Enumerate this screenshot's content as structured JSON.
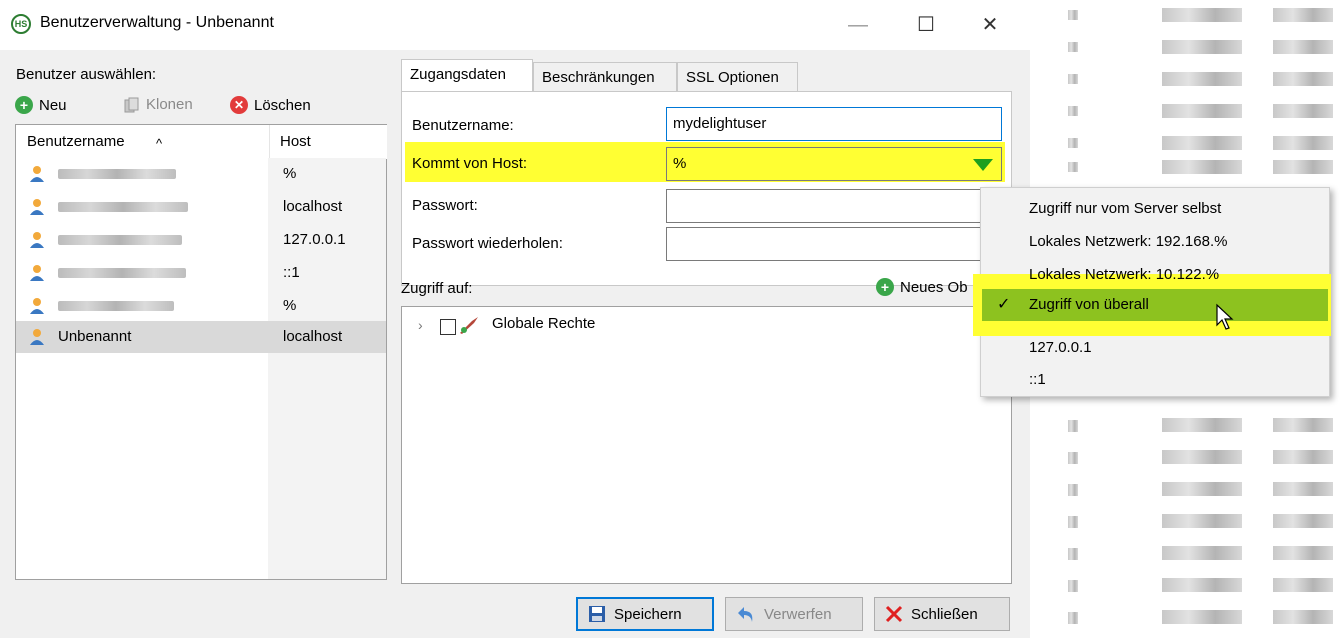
{
  "window": {
    "title": "Benutzerverwaltung - Unbenannt",
    "logo_text": "HS",
    "minimize": "—",
    "maximize": "☐",
    "close": "✕"
  },
  "left": {
    "heading": "Benutzer auswählen:",
    "toolbar": {
      "new_label": "Neu",
      "clone_label": "Klonen",
      "delete_label": "Löschen"
    },
    "columns": {
      "username": "Benutzername",
      "host": "Host",
      "sort_indicator": "^"
    },
    "rows": [
      {
        "username": "",
        "host": "%"
      },
      {
        "username": "",
        "host": "localhost"
      },
      {
        "username": "",
        "host": "127.0.0.1"
      },
      {
        "username": "",
        "host": "::1"
      },
      {
        "username": "",
        "host": "%"
      },
      {
        "username": "Unbenannt",
        "host": "localhost",
        "selected": true
      }
    ]
  },
  "tabs": [
    "Zugangsdaten",
    "Beschränkungen",
    "SSL Optionen"
  ],
  "form": {
    "username_label": "Benutzername:",
    "username_value": "mydelightuser",
    "host_label": "Kommt von Host:",
    "host_value": "%",
    "password_label": "Passwort:",
    "password_repeat_label": "Passwort wiederholen:"
  },
  "access": {
    "label": "Zugriff auf:",
    "new_object_label": "Neues Ob",
    "tree_item": "Globale Rechte"
  },
  "buttons": {
    "save": "Speichern",
    "discard": "Verwerfen",
    "close": "Schließen"
  },
  "dropdown": {
    "items": [
      "Zugriff nur vom Server selbst",
      "Lokales Netzwerk: 192.168.%",
      "Lokales Netzwerk: 10.122.%",
      "Zugriff von überall",
      "127.0.0.1",
      "::1"
    ],
    "checked_index": 3,
    "check_mark": "✓"
  },
  "colors": {
    "highlight": "#ffff33",
    "dropdown_selected": "#8dc21f",
    "new_icon": "#3aa64a",
    "delete_icon": "#e23b3b",
    "accent": "#0078d7"
  },
  "icons": [
    "app-logo-icon",
    "plus-icon",
    "clone-icon",
    "delete-icon",
    "user-icon",
    "dropdown-arrow-icon",
    "expand-chevron-icon",
    "checkbox-icon",
    "privilege-icon",
    "save-icon",
    "undo-icon",
    "close-x-icon",
    "checkmark-icon",
    "mouse-cursor-icon"
  ]
}
